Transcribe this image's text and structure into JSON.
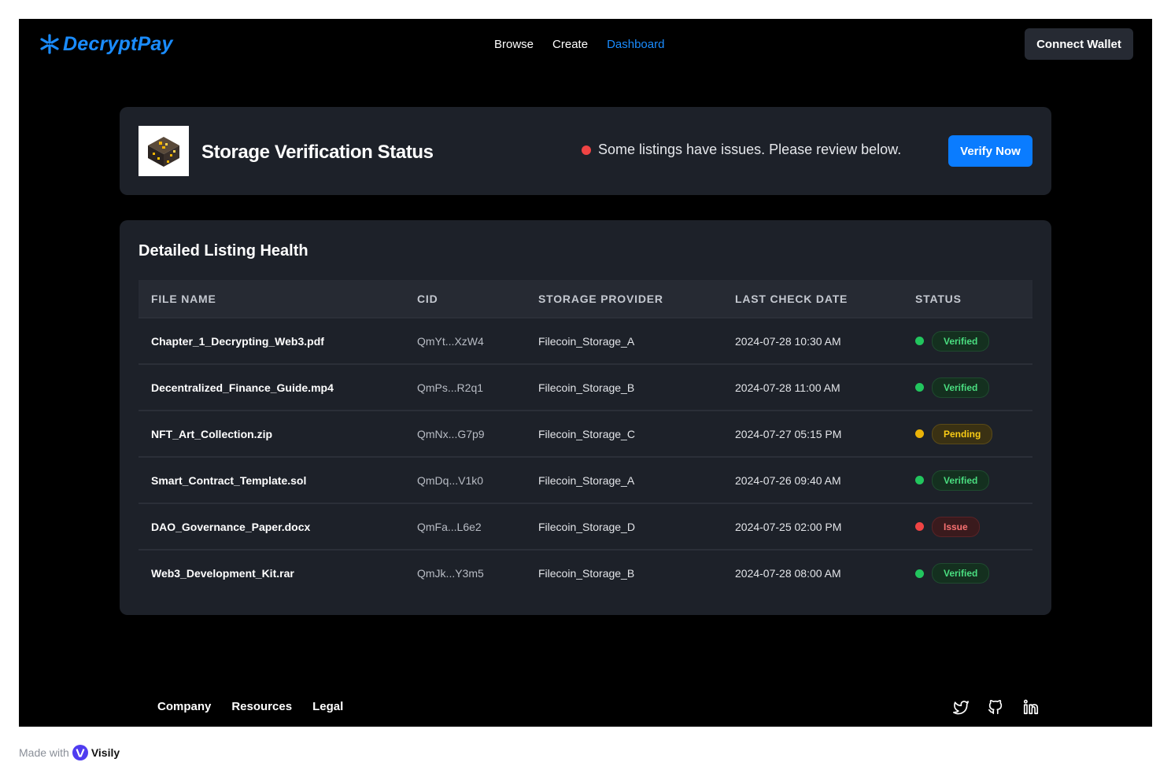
{
  "header": {
    "logo_text": "DecryptPay",
    "nav": [
      {
        "label": "Browse",
        "active": false
      },
      {
        "label": "Create",
        "active": false
      },
      {
        "label": "Dashboard",
        "active": true
      }
    ],
    "connect_label": "Connect Wallet"
  },
  "status_card": {
    "title": "Storage Verification Status",
    "message": "Some listings have issues. Please review below.",
    "verify_label": "Verify Now"
  },
  "listing": {
    "title": "Detailed Listing Health",
    "columns": [
      "FILE NAME",
      "CID",
      "STORAGE PROVIDER",
      "LAST CHECK DATE",
      "STATUS"
    ],
    "rows": [
      {
        "file": "Chapter_1_Decrypting_Web3.pdf",
        "cid": "QmYt...XzW4",
        "provider": "Filecoin_Storage_A",
        "date": "2024-07-28 10:30 AM",
        "status": "Verified"
      },
      {
        "file": "Decentralized_Finance_Guide.mp4",
        "cid": "QmPs...R2q1",
        "provider": "Filecoin_Storage_B",
        "date": "2024-07-28 11:00 AM",
        "status": "Verified"
      },
      {
        "file": "NFT_Art_Collection.zip",
        "cid": "QmNx...G7p9",
        "provider": "Filecoin_Storage_C",
        "date": "2024-07-27 05:15 PM",
        "status": "Pending"
      },
      {
        "file": "Smart_Contract_Template.sol",
        "cid": "QmDq...V1k0",
        "provider": "Filecoin_Storage_A",
        "date": "2024-07-26 09:40 AM",
        "status": "Verified"
      },
      {
        "file": "DAO_Governance_Paper.docx",
        "cid": "QmFa...L6e2",
        "provider": "Filecoin_Storage_D",
        "date": "2024-07-25 02:00 PM",
        "status": "Issue"
      },
      {
        "file": "Web3_Development_Kit.rar",
        "cid": "QmJk...Y3m5",
        "provider": "Filecoin_Storage_B",
        "date": "2024-07-28 08:00 AM",
        "status": "Verified"
      }
    ]
  },
  "footer": {
    "links": [
      "Company",
      "Resources",
      "Legal"
    ],
    "social_icons": [
      "twitter-icon",
      "github-icon",
      "linkedin-icon"
    ]
  },
  "made_with": {
    "prefix": "Made with",
    "brand": "Visily"
  },
  "colors": {
    "accent": "#1a8cff",
    "primary_button": "#0a7cff",
    "verified": "#22c55e",
    "pending": "#eab308",
    "issue": "#ef4444"
  }
}
